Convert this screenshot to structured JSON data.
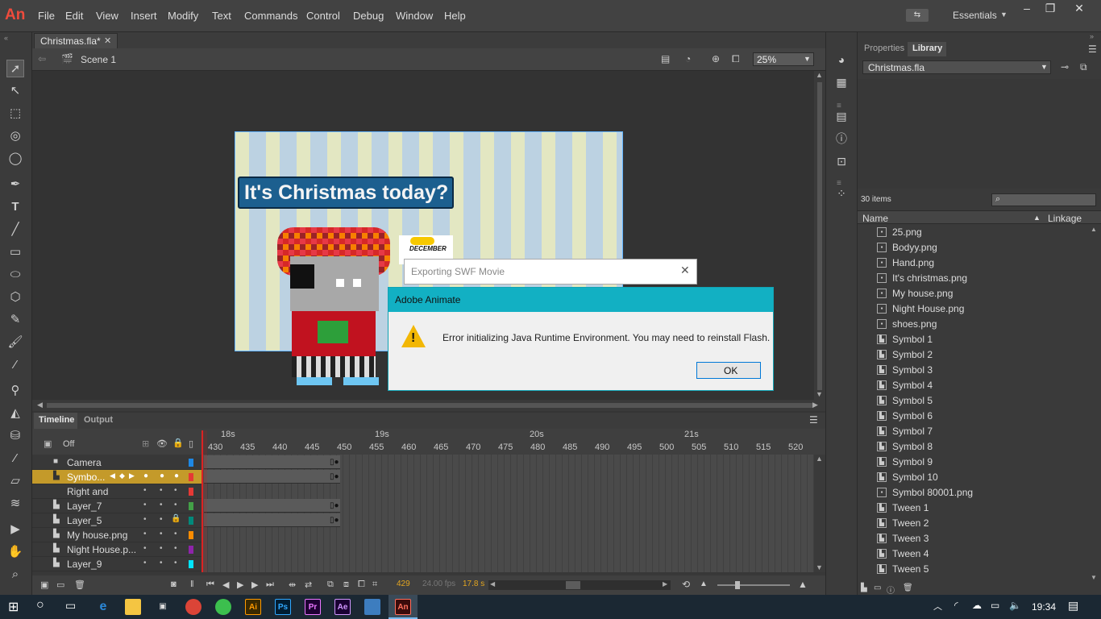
{
  "app": {
    "logo": "An"
  },
  "menu": [
    "File",
    "Edit",
    "View",
    "Insert",
    "Modify",
    "Text",
    "Commands",
    "Control",
    "Debug",
    "Window",
    "Help"
  ],
  "workspace": {
    "label": "Essentials"
  },
  "document": {
    "tab": "Christmas.fla*",
    "scene": "Scene 1",
    "zoom": "25%"
  },
  "stage": {
    "banner": "It's Christmas today?",
    "sticker": "DECEMBER"
  },
  "timeline": {
    "tabs": [
      "Timeline",
      "Output"
    ],
    "camera_state": "Off",
    "seconds": [
      "18s",
      "19s",
      "20s",
      "21s"
    ],
    "frame_numbers": [
      "430",
      "435",
      "440",
      "445",
      "450",
      "455",
      "460",
      "465",
      "470",
      "475",
      "480",
      "485",
      "490",
      "495",
      "500",
      "505",
      "510",
      "515",
      "520"
    ],
    "layers": [
      {
        "name": "Camera",
        "color": "#1e88e5"
      },
      {
        "name": "Symbo...",
        "color": "#e53935"
      },
      {
        "name": "Right and",
        "color": "#e53935"
      },
      {
        "name": "Layer_7",
        "color": "#43a047"
      },
      {
        "name": "Layer_5",
        "color": "#00897b"
      },
      {
        "name": "My house.png",
        "color": "#fb8c00"
      },
      {
        "name": "Night House.p...",
        "color": "#8e24aa"
      },
      {
        "name": "Layer_9",
        "color": "#00e5ff"
      }
    ],
    "current_frame": "429",
    "fps": "24.00 fps",
    "elapsed": "17.8 s"
  },
  "library": {
    "tabs": [
      "Properties",
      "Library"
    ],
    "file": "Christmas.fla",
    "count": "30 items",
    "col_name": "Name",
    "col_linkage": "Linkage",
    "items": [
      {
        "name": "25.png",
        "type": "bitmap"
      },
      {
        "name": "Bodyy.png",
        "type": "bitmap"
      },
      {
        "name": "Hand.png",
        "type": "bitmap"
      },
      {
        "name": "It's christmas.png",
        "type": "bitmap"
      },
      {
        "name": "My house.png",
        "type": "bitmap"
      },
      {
        "name": "Night House.png",
        "type": "bitmap"
      },
      {
        "name": "shoes.png",
        "type": "bitmap"
      },
      {
        "name": "Symbol 1",
        "type": "symbol"
      },
      {
        "name": "Symbol 2",
        "type": "symbol"
      },
      {
        "name": "Symbol 3",
        "type": "symbol"
      },
      {
        "name": "Symbol 4",
        "type": "symbol"
      },
      {
        "name": "Symbol 5",
        "type": "symbol"
      },
      {
        "name": "Symbol 6",
        "type": "symbol"
      },
      {
        "name": "Symbol 7",
        "type": "symbol"
      },
      {
        "name": "Symbol 8",
        "type": "symbol"
      },
      {
        "name": "Symbol 9",
        "type": "symbol"
      },
      {
        "name": "Symbol 10",
        "type": "symbol"
      },
      {
        "name": "Symbol 80001.png",
        "type": "bitmap"
      },
      {
        "name": "Tween 1",
        "type": "symbol"
      },
      {
        "name": "Tween 2",
        "type": "symbol"
      },
      {
        "name": "Tween 3",
        "type": "symbol"
      },
      {
        "name": "Tween 4",
        "type": "symbol"
      },
      {
        "name": "Tween 5",
        "type": "symbol"
      }
    ]
  },
  "dialogs": {
    "export_title": "Exporting SWF Movie",
    "alert_title": "Adobe Animate",
    "alert_message": "Error initializing Java Runtime Environment.  You may need to reinstall Flash.",
    "ok_label": "OK"
  },
  "taskbar": {
    "clock": "19:34",
    "apps": [
      "Ai",
      "Ps",
      "Pr",
      "Ae",
      "An"
    ]
  }
}
